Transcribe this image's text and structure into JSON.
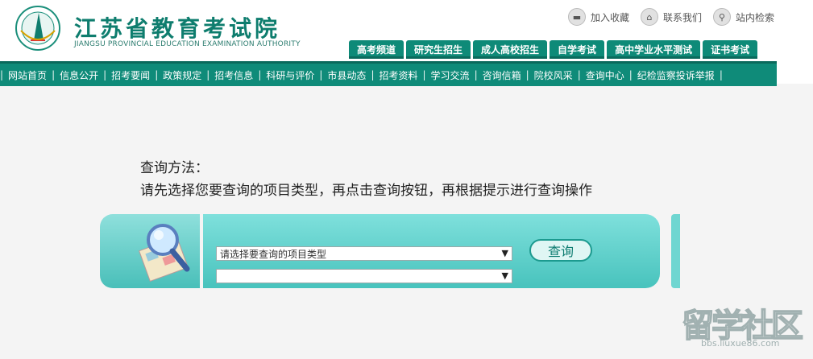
{
  "header": {
    "logo_cn": "江苏省教育考试院",
    "logo_en": "JIANGSU PROVINCIAL EDUCATION EXAMINATION AUTHORITY",
    "utilities": [
      {
        "label": "加入收藏",
        "icon": "bookmark-icon"
      },
      {
        "label": "联系我们",
        "icon": "home-icon"
      },
      {
        "label": "站内检索",
        "icon": "search-icon"
      }
    ],
    "tabs": [
      "高考频道",
      "研究生招生",
      "成人高校招生",
      "自学考试",
      "高中学业水平测试",
      "证书考试"
    ]
  },
  "nav": [
    "网站首页",
    "信息公开",
    "招考要闻",
    "政策规定",
    "招考信息",
    "科研与评价",
    "市县动态",
    "招考资料",
    "学习交流",
    "咨询信箱",
    "院校风采",
    "查询中心",
    "纪检监察投诉举报"
  ],
  "instructions": {
    "line1": "查询方法：",
    "line2": "请先选择您要查询的项目类型，再点击查询按钮，再根据提示进行查询操作"
  },
  "query": {
    "select_type_value": "请选择要查询的项目类型",
    "select_sub_value": "",
    "button_label": "查询"
  },
  "watermark": {
    "text": "留学社区",
    "url": "bbs.liuxue86.com"
  },
  "colors": {
    "brand_green": "#0e8a78",
    "panel_teal": "#48c3bd"
  }
}
